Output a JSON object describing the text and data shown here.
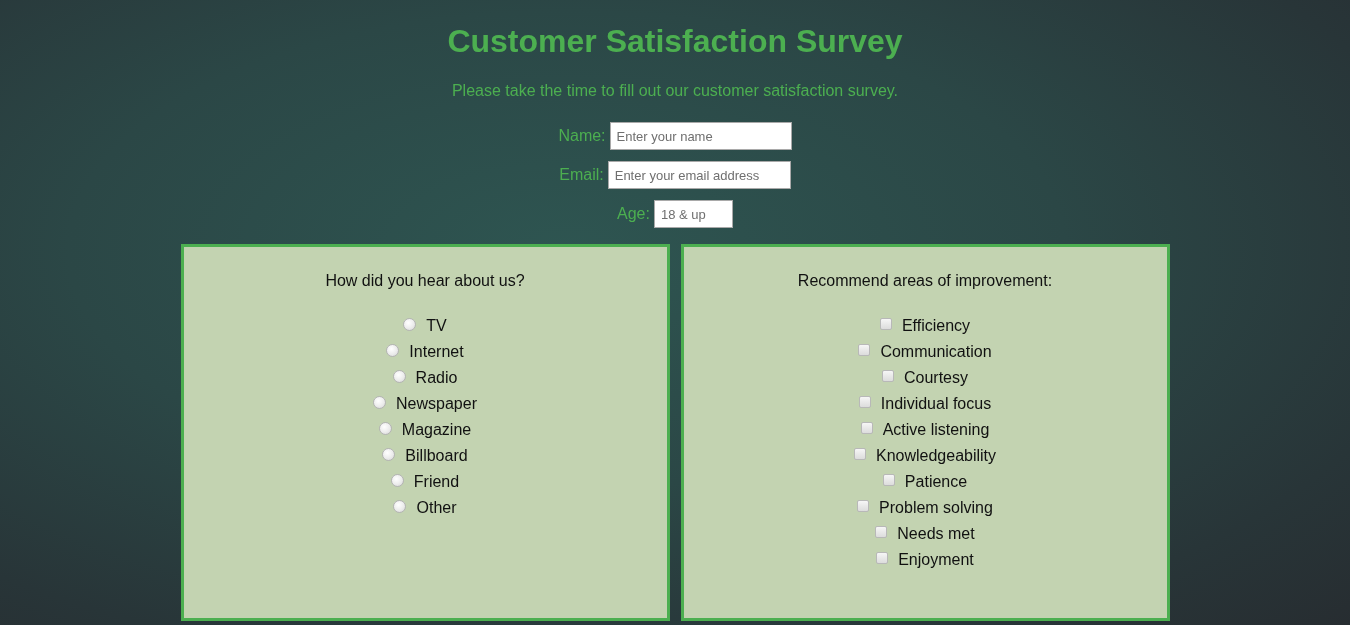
{
  "title": "Customer Satisfaction Survey",
  "subtitle": "Please take the time to fill out our customer satisfaction survey.",
  "fields": [
    {
      "label": "Name:",
      "placeholder": "Enter your name",
      "kind": "text"
    },
    {
      "label": "Email:",
      "placeholder": "Enter your email address",
      "kind": "email"
    },
    {
      "label": "Age:",
      "placeholder": "18 & up",
      "kind": "age"
    }
  ],
  "panels": [
    {
      "question": "How did you hear about us?",
      "kind": "radio",
      "options": [
        {
          "label": "TV",
          "selected": false
        },
        {
          "label": "Internet",
          "selected": false
        },
        {
          "label": "Radio",
          "selected": false
        },
        {
          "label": "Newspaper",
          "selected": false
        },
        {
          "label": "Magazine",
          "selected": false
        },
        {
          "label": "Billboard",
          "selected": false
        },
        {
          "label": "Friend",
          "selected": false
        },
        {
          "label": "Other",
          "selected": false
        }
      ]
    },
    {
      "question": "Recommend areas of improvement:",
      "kind": "checkbox",
      "options": [
        {
          "label": "Efficiency",
          "checked": false
        },
        {
          "label": "Communication",
          "checked": false
        },
        {
          "label": "Courtesy",
          "checked": false
        },
        {
          "label": "Individual focus",
          "checked": false
        },
        {
          "label": "Active listening",
          "checked": false
        },
        {
          "label": "Knowledgeability",
          "checked": false
        },
        {
          "label": "Patience",
          "checked": false
        },
        {
          "label": "Problem solving",
          "checked": false
        },
        {
          "label": "Needs met",
          "checked": false
        },
        {
          "label": "Enjoyment",
          "checked": false
        }
      ]
    }
  ]
}
